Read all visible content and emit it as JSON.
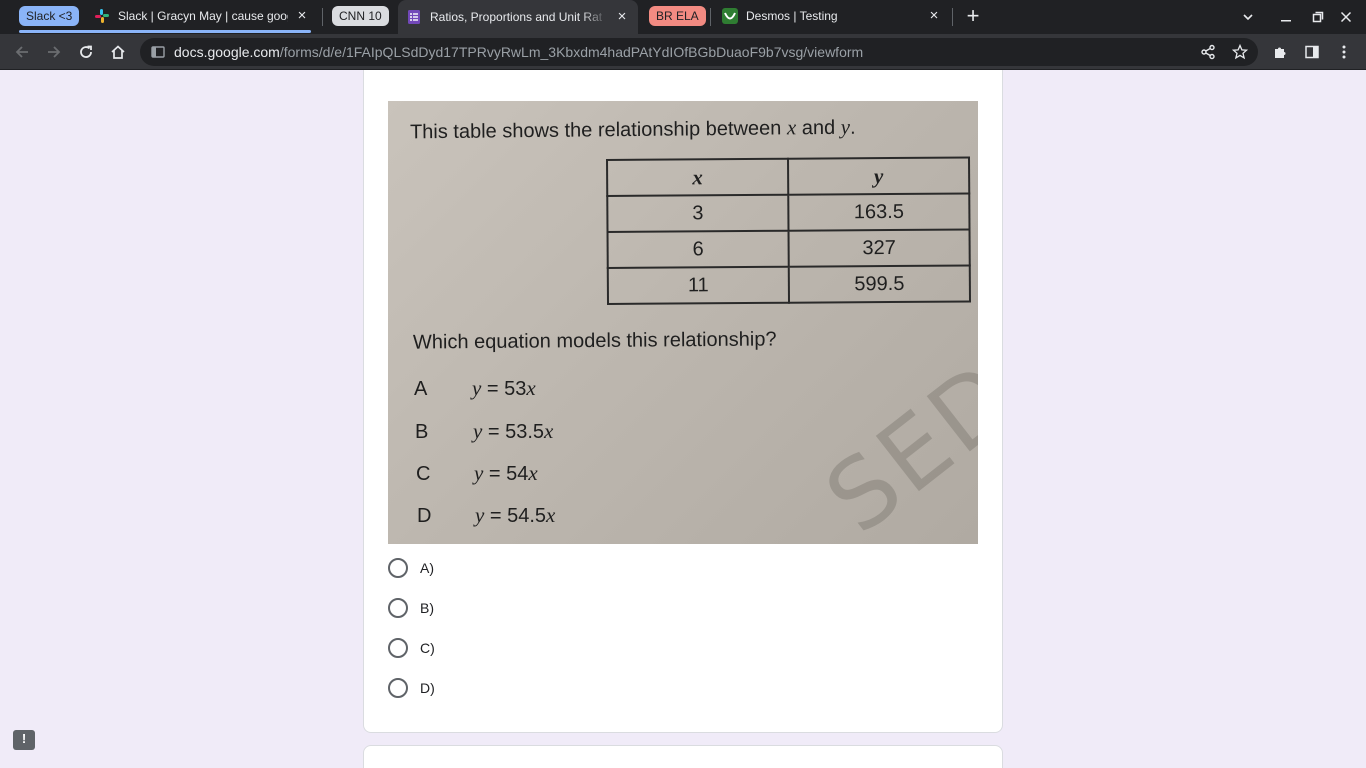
{
  "browser": {
    "tab_groups": [
      {
        "label": "Slack <3",
        "color": "#8ab4f8"
      },
      {
        "label": "CNN 10",
        "color": "#dadce0"
      },
      {
        "label": "BR ELA",
        "color": "#f28b82"
      }
    ],
    "tabs": [
      {
        "title": "Slack | Gracyn May | cause goog",
        "icon": "slack-icon"
      },
      {
        "title": "Ratios, Proportions and Unit Rat",
        "icon": "google-forms-icon",
        "active": true
      },
      {
        "title": "Desmos | Testing",
        "icon": "desmos-icon"
      }
    ],
    "url_host": "docs.google.com",
    "url_path": "/forms/d/e/1FAIpQLSdDyd17TPRvyRwLm_3Kbxdm4hadPAtYdIOfBGbDuaoF9b7vsg/viewform"
  },
  "question": {
    "image": {
      "intro_before": "This table shows the relationship between ",
      "intro_var1": "x",
      "intro_and": " and ",
      "intro_var2": "y",
      "intro_end": ".",
      "table": {
        "headers": [
          "x",
          "y"
        ],
        "rows": [
          [
            "3",
            "163.5"
          ],
          [
            "6",
            "327"
          ],
          [
            "11",
            "599.5"
          ]
        ]
      },
      "prompt": "Which equation models this relationship?",
      "choices": [
        {
          "letter": "A",
          "lhs": "y",
          "rhs": " = 53",
          "var": "x"
        },
        {
          "letter": "B",
          "lhs": "y",
          "rhs": " = 53.5",
          "var": "x"
        },
        {
          "letter": "C",
          "lhs": "y",
          "rhs": " = 54",
          "var": "x"
        },
        {
          "letter": "D",
          "lhs": "y",
          "rhs": " = 54.5",
          "var": "x"
        }
      ],
      "stamp_text": "SED"
    },
    "options": [
      "A)",
      "B)",
      "C)",
      "D)"
    ]
  },
  "feedback_label": "!"
}
